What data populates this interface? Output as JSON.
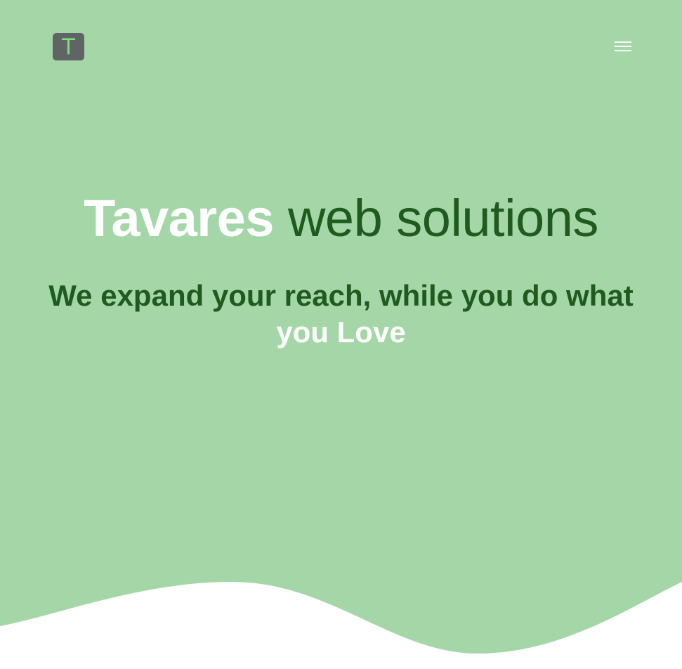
{
  "colors": {
    "hero_background": "#a5d6a7",
    "page_background": "#ffffff",
    "heading_dark": "#1f5a1f",
    "heading_light": "#ffffff",
    "logo_background": "#616464",
    "logo_letter": "#7ddb81"
  },
  "header": {
    "logo_letter": "T",
    "menu_icon": "hamburger-menu-icon"
  },
  "hero": {
    "title_strong": "Tavares",
    "title_rest": " web solutions",
    "subtitle_main": "We expand your reach, while you do what ",
    "subtitle_accent": "you Love"
  }
}
